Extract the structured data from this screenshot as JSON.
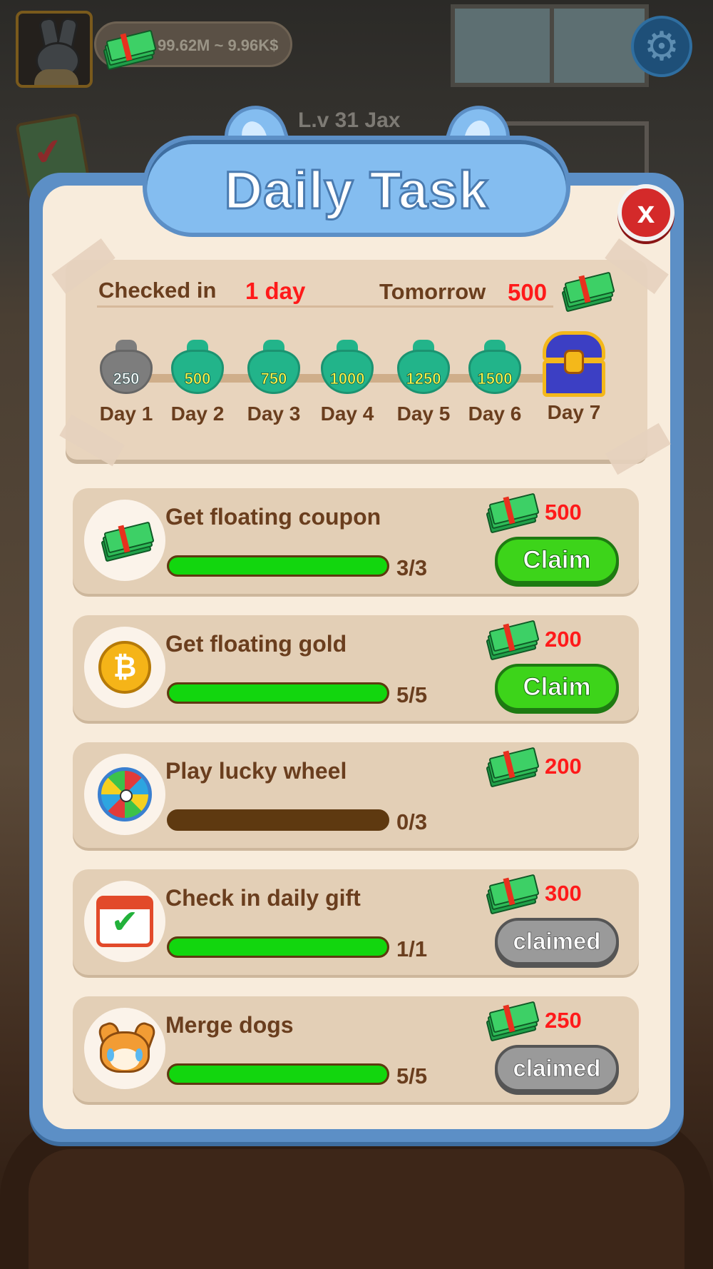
{
  "hud": {
    "money_text": "99.62M ~ 9.96K$",
    "level_text": "L.v 31 Jax",
    "settings_icon": "gear-icon"
  },
  "dialog": {
    "title": "Daily Task",
    "close_label": "x"
  },
  "checkin": {
    "checked_label": "Checked in",
    "checked_value": "1 day",
    "tomorrow_label": "Tomorrow",
    "tomorrow_value": "500",
    "days": [
      {
        "label": "Day 1",
        "amount": "250",
        "state": "collected"
      },
      {
        "label": "Day 2",
        "amount": "500",
        "state": "pending"
      },
      {
        "label": "Day 3",
        "amount": "750",
        "state": "pending"
      },
      {
        "label": "Day 4",
        "amount": "1000",
        "state": "pending"
      },
      {
        "label": "Day 5",
        "amount": "1250",
        "state": "pending"
      },
      {
        "label": "Day 6",
        "amount": "1500",
        "state": "pending"
      },
      {
        "label": "Day 7",
        "amount": "",
        "state": "chest"
      }
    ]
  },
  "tasks": [
    {
      "name": "Get floating coupon",
      "progress_text": "3/3",
      "progress": 1.0,
      "reward": "500",
      "button": "Claim",
      "button_state": "claim",
      "icon": "cash-icon"
    },
    {
      "name": "Get floating gold",
      "progress_text": "5/5",
      "progress": 1.0,
      "reward": "200",
      "button": "Claim",
      "button_state": "claim",
      "icon": "bitcoin-coin-icon"
    },
    {
      "name": "Play lucky wheel",
      "progress_text": "0/3",
      "progress": 0.0,
      "reward": "200",
      "button": "",
      "button_state": "none",
      "icon": "lucky-wheel-icon"
    },
    {
      "name": "Check in daily gift",
      "progress_text": "1/1",
      "progress": 1.0,
      "reward": "300",
      "button": "claimed",
      "button_state": "claimed",
      "icon": "calendar-check-icon"
    },
    {
      "name": "Merge dogs",
      "progress_text": "5/5",
      "progress": 1.0,
      "reward": "250",
      "button": "claimed",
      "button_state": "claimed",
      "icon": "crying-dog-icon"
    }
  ],
  "colors": {
    "accent_red": "#ff1a1a",
    "progress_green": "#12d60e",
    "panel_blue": "#5c8fc6",
    "text_brown": "#6a3e1e"
  }
}
